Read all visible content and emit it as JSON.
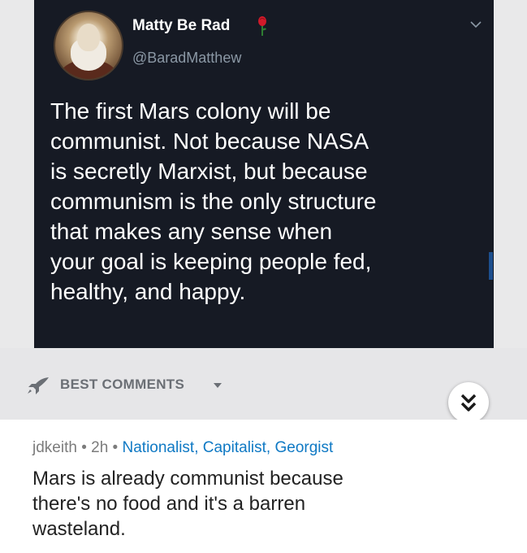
{
  "tweet": {
    "display_name": "Matty Be Rad",
    "handle": "@BaradMatthew",
    "text": "The first Mars colony will be\ncommunist. Not because NASA\nis secretly Marxist, but because\ncommunism is the only structure\nthat makes any sense when\nyour goal is keeping people fed,\nhealthy, and happy.",
    "avatar_icon": "karl-marx-portrait",
    "name_badge_icon": "rose-icon",
    "menu_icon": "chevron-down-icon",
    "colors": {
      "background": "#161a24",
      "text": "#ffffff",
      "muted": "#8b98a5",
      "rose": "#d11a2a"
    }
  },
  "comments_section": {
    "sort_label": "BEST COMMENTS",
    "sort_icon": "rocket-icon",
    "collapse_icon": "double-chevron-down-icon"
  },
  "comment": {
    "author": "jdkeith",
    "separator": " • ",
    "age": "2h",
    "flair": "Nationalist, Capitalist, Georgist",
    "body": "Mars is already communist because\nthere's no food and it's a barren\nwasteland.",
    "colors": {
      "flair": "#0f79c4",
      "meta": "#7c7c7c"
    }
  }
}
